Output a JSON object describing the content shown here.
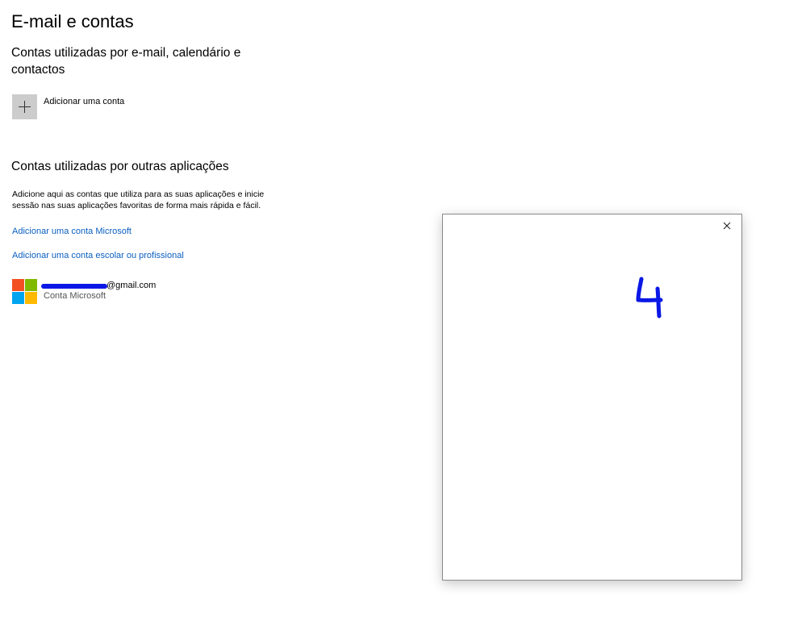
{
  "page": {
    "title": "E-mail e contas"
  },
  "email_section": {
    "heading": "Contas utilizadas por e-mail, calendário e contactos",
    "add_account_label": "Adicionar uma conta",
    "add_icon": "plus-icon"
  },
  "apps_section": {
    "heading": "Contas utilizadas por outras aplicações",
    "description": "Adicione aqui as contas que utiliza para as suas aplicações e inicie sessão nas suas aplicações favoritas de forma mais rápida e fácil.",
    "link_microsoft": "Adicionar uma conta Microsoft",
    "link_work": "Adicionar uma conta escolar ou profissional",
    "link_color": "#0a5fc2"
  },
  "account": {
    "email_visible": "@gmail.com",
    "type": "Conta Microsoft",
    "icon": "microsoft-logo-icon",
    "logo_colors": [
      "#f25022",
      "#7fba00",
      "#00a4ef",
      "#ffb900"
    ]
  },
  "popup": {
    "close_icon": "close-icon",
    "annotation": "4",
    "annotation_color": "#0a18e6"
  }
}
